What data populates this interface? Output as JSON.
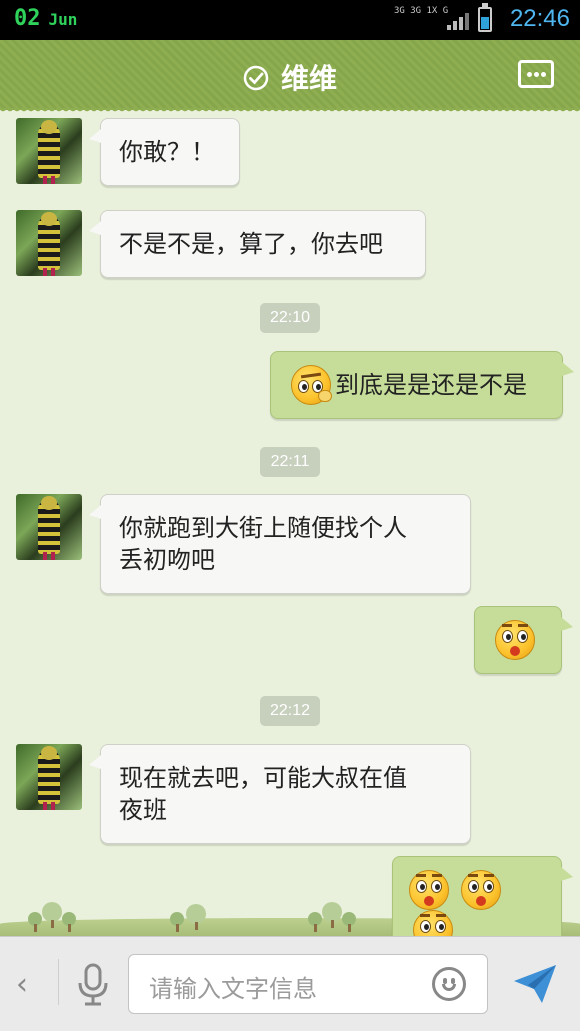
{
  "status_bar": {
    "date_day": "02",
    "date_month": "Jun",
    "network": "3G 3G 1X G",
    "time": "22:46",
    "battery_level": 0.55
  },
  "header": {
    "contact_name": "维维",
    "icons": {
      "status": "check-circle-icon",
      "menu": "more-dots-icon"
    }
  },
  "messages": [
    {
      "side": "left",
      "text": "你敢？！"
    },
    {
      "side": "left",
      "text": "不是不是，算了，你去吧"
    },
    {
      "type": "timestamp",
      "text": "22:10"
    },
    {
      "side": "right",
      "emoji": "thinking-emoji",
      "text": "到底是是还是不是"
    },
    {
      "type": "timestamp",
      "text": "22:11"
    },
    {
      "side": "left",
      "text_line1": "你就跑到大街上随便找个人",
      "text_line2": "丢初吻吧"
    },
    {
      "side": "right",
      "emoji": "scared-emoji"
    },
    {
      "type": "timestamp",
      "text": "22:12"
    },
    {
      "side": "left",
      "text_line1": "现在就去吧，可能大叔在值",
      "text_line2": "夜班"
    },
    {
      "side": "right",
      "emoji": "scared-emoji",
      "count": 3
    }
  ],
  "input_bar": {
    "placeholder": "请输入文字信息",
    "back_glyph": "‹",
    "icons": {
      "voice": "microphone-icon",
      "emoji": "smiley-icon",
      "send": "send-icon"
    }
  },
  "colors": {
    "header_green": "#8fae52",
    "chat_bg": "#e9f1dc",
    "right_bubble": "#c6dd9a",
    "left_bubble": "#f7f7f5",
    "time_blue": "#4fb6f0"
  }
}
